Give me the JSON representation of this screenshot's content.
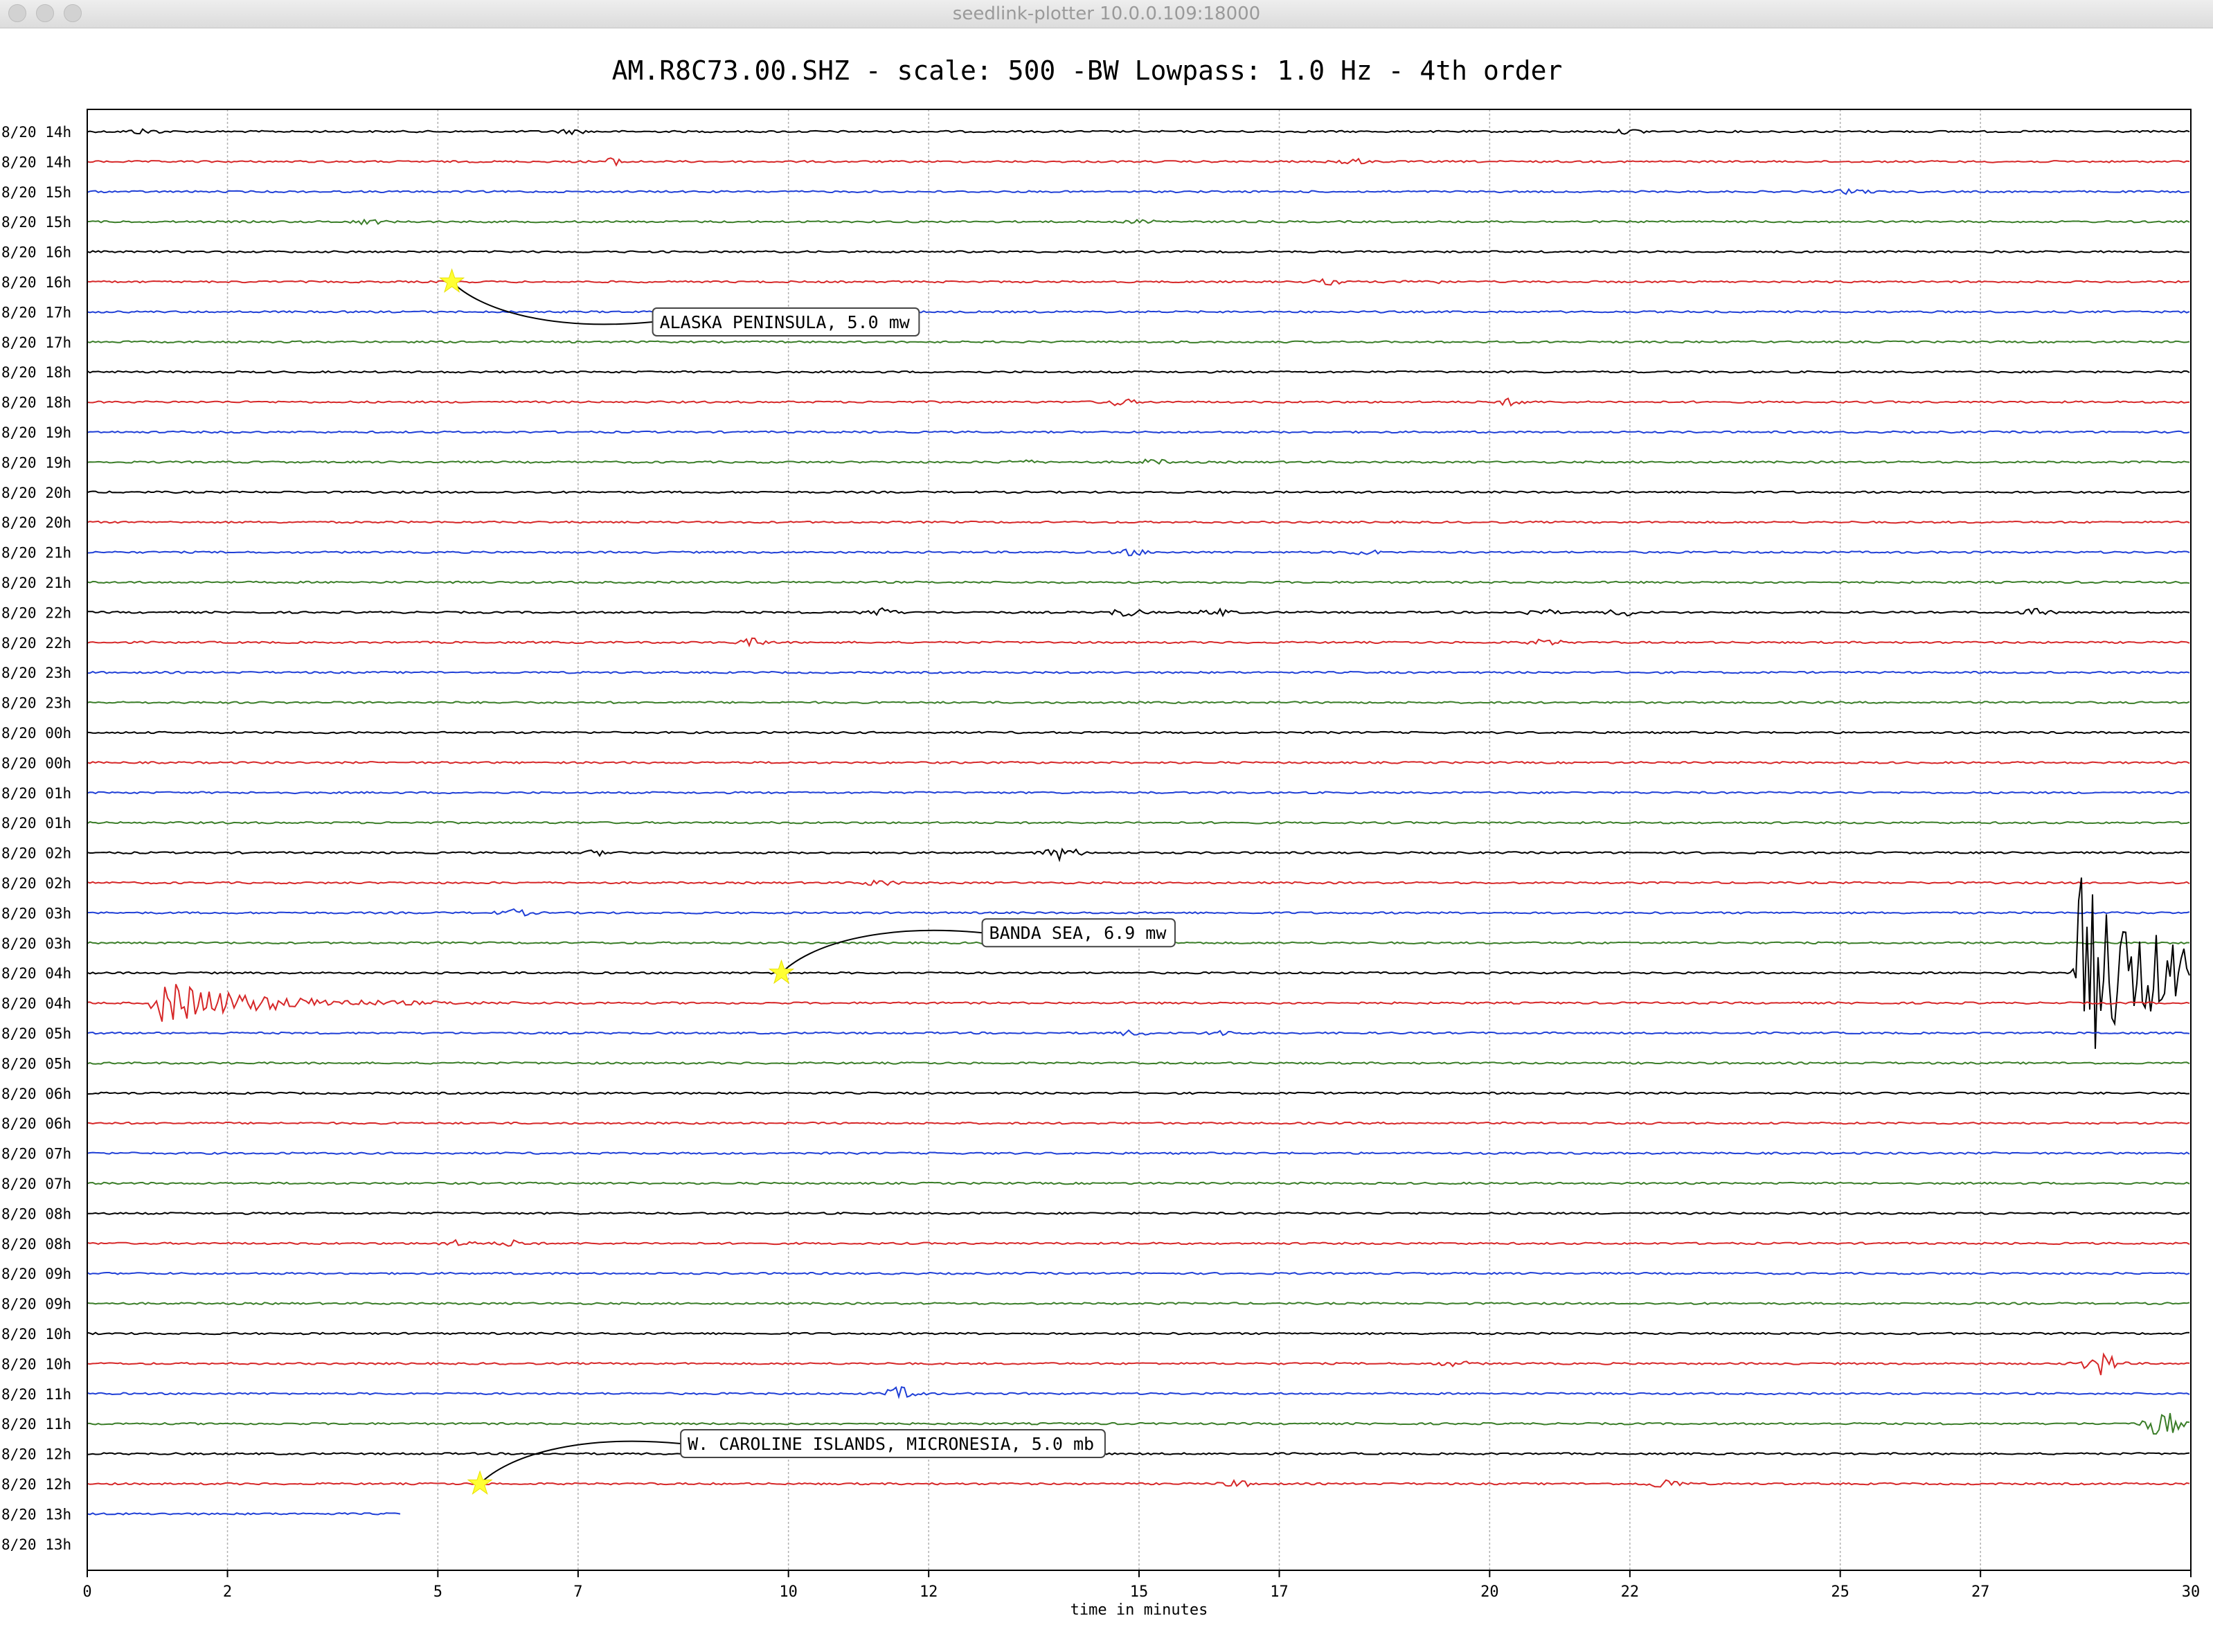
{
  "window": {
    "title": "seedlink-plotter 10.0.0.109:18000",
    "buttons": [
      "close",
      "minimize",
      "zoom"
    ]
  },
  "colors": {
    "trace_cycle": [
      "#000000",
      "#d62728",
      "#1f3fd6",
      "#3a7d28"
    ],
    "event_star": "#ffff33",
    "grid": "#b0b0b0"
  },
  "chart_data": {
    "type": "line",
    "title": "AM.R8C73.00.SHZ - scale: 500 -BW Lowpass: 1.0 Hz - 4th order",
    "xlabel": "time in minutes",
    "xlim": [
      0,
      30
    ],
    "x_ticks": [
      0,
      2,
      5,
      7,
      10,
      12,
      15,
      17,
      20,
      22,
      25,
      27,
      30
    ],
    "grid": "vertical",
    "row_labels": [
      "8/20 14h",
      "8/20 14h",
      "8/20 15h",
      "8/20 15h",
      "8/20 16h",
      "8/20 16h",
      "8/20 17h",
      "8/20 17h",
      "8/20 18h",
      "8/20 18h",
      "8/20 19h",
      "8/20 19h",
      "8/20 20h",
      "8/20 20h",
      "8/20 21h",
      "8/20 21h",
      "8/20 22h",
      "8/20 22h",
      "8/20 23h",
      "8/20 23h",
      "8/20 00h",
      "8/20 00h",
      "8/20 01h",
      "8/20 01h",
      "8/20 02h",
      "8/20 02h",
      "8/20 03h",
      "8/20 03h",
      "8/20 04h",
      "8/20 04h",
      "8/20 05h",
      "8/20 05h",
      "8/20 06h",
      "8/20 06h",
      "8/20 07h",
      "8/20 07h",
      "8/20 08h",
      "8/20 08h",
      "8/20 09h",
      "8/20 09h",
      "8/20 10h",
      "8/20 10h",
      "8/20 11h",
      "8/20 11h",
      "8/20 12h",
      "8/20 12h",
      "8/20 13h",
      "8/20 13h"
    ],
    "trace_end_minutes": [
      30,
      30,
      30,
      30,
      30,
      30,
      30,
      30,
      30,
      30,
      30,
      30,
      30,
      30,
      30,
      30,
      30,
      30,
      30,
      30,
      30,
      30,
      30,
      30,
      30,
      30,
      30,
      30,
      30,
      30,
      30,
      30,
      30,
      30,
      30,
      30,
      30,
      30,
      30,
      30,
      30,
      30,
      30,
      30,
      30,
      30,
      4.5,
      0
    ],
    "bursts": [
      {
        "row": 0,
        "minute": 0.8,
        "amp": 0.15
      },
      {
        "row": 0,
        "minute": 6.9,
        "amp": 0.12
      },
      {
        "row": 0,
        "minute": 22.0,
        "amp": 0.12
      },
      {
        "row": 1,
        "minute": 7.5,
        "amp": 0.2
      },
      {
        "row": 1,
        "minute": 18.0,
        "amp": 0.2
      },
      {
        "row": 2,
        "minute": 25.2,
        "amp": 0.15
      },
      {
        "row": 3,
        "minute": 4.0,
        "amp": 0.15
      },
      {
        "row": 3,
        "minute": 15.1,
        "amp": 0.12
      },
      {
        "row": 5,
        "minute": 17.7,
        "amp": 0.15
      },
      {
        "row": 5,
        "minute": 19.1,
        "amp": 0.12
      },
      {
        "row": 9,
        "minute": 14.7,
        "amp": 0.2
      },
      {
        "row": 9,
        "minute": 20.3,
        "amp": 0.2
      },
      {
        "row": 11,
        "minute": 13.3,
        "amp": 0.12
      },
      {
        "row": 11,
        "minute": 15.2,
        "amp": 0.15
      },
      {
        "row": 14,
        "minute": 14.9,
        "amp": 0.18
      },
      {
        "row": 14,
        "minute": 18.2,
        "amp": 0.15
      },
      {
        "row": 16,
        "minute": 11.3,
        "amp": 0.25
      },
      {
        "row": 16,
        "minute": 14.8,
        "amp": 0.25
      },
      {
        "row": 16,
        "minute": 16.1,
        "amp": 0.2
      },
      {
        "row": 16,
        "minute": 20.7,
        "amp": 0.2
      },
      {
        "row": 16,
        "minute": 21.9,
        "amp": 0.2
      },
      {
        "row": 16,
        "minute": 27.8,
        "amp": 0.2
      },
      {
        "row": 17,
        "minute": 9.5,
        "amp": 0.22
      },
      {
        "row": 17,
        "minute": 20.8,
        "amp": 0.18
      },
      {
        "row": 24,
        "minute": 7.3,
        "amp": 0.15
      },
      {
        "row": 24,
        "minute": 13.9,
        "amp": 0.45
      },
      {
        "row": 25,
        "minute": 11.3,
        "amp": 0.2
      },
      {
        "row": 26,
        "minute": 6.1,
        "amp": 0.2
      },
      {
        "row": 28,
        "minute": 28.4,
        "amp": 6.5
      },
      {
        "row": 29,
        "minute": 1.0,
        "amp": 1.6
      },
      {
        "row": 30,
        "minute": 14.9,
        "amp": 0.15
      },
      {
        "row": 30,
        "minute": 16.2,
        "amp": 0.15
      },
      {
        "row": 37,
        "minute": 5.3,
        "amp": 0.18
      },
      {
        "row": 37,
        "minute": 6.1,
        "amp": 0.18
      },
      {
        "row": 41,
        "minute": 28.7,
        "amp": 0.8
      },
      {
        "row": 41,
        "minute": 19.5,
        "amp": 0.15
      },
      {
        "row": 42,
        "minute": 11.6,
        "amp": 0.4
      },
      {
        "row": 43,
        "minute": 29.6,
        "amp": 0.9
      },
      {
        "row": 45,
        "minute": 22.5,
        "amp": 0.3
      },
      {
        "row": 45,
        "minute": 16.4,
        "amp": 0.18
      }
    ],
    "annotations": [
      {
        "label": "ALASKA PENINSULA, 5.0 mw",
        "row": 5,
        "minute": 5.2
      },
      {
        "label": "BANDA SEA, 6.9 mw",
        "row": 28,
        "minute": 9.9
      },
      {
        "label": "W. CAROLINE ISLANDS, MICRONESIA, 5.0 mb",
        "row": 45,
        "minute": 5.6
      }
    ]
  }
}
